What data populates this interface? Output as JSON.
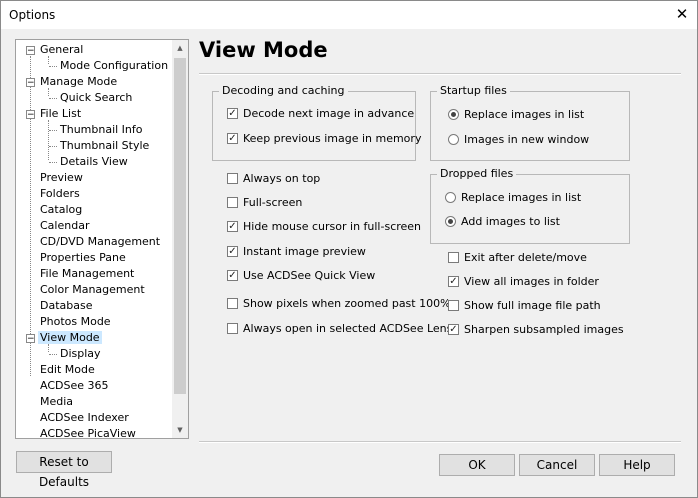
{
  "window": {
    "title": "Options",
    "close_glyph": "✕"
  },
  "tree": {
    "items": [
      {
        "label": "General",
        "expander": "−"
      },
      {
        "label": "Mode Configuration"
      },
      {
        "label": "Manage Mode",
        "expander": "−"
      },
      {
        "label": "Quick Search"
      },
      {
        "label": "File List",
        "expander": "−"
      },
      {
        "label": "Thumbnail Info"
      },
      {
        "label": "Thumbnail Style"
      },
      {
        "label": "Details View"
      },
      {
        "label": "Preview"
      },
      {
        "label": "Folders"
      },
      {
        "label": "Catalog"
      },
      {
        "label": "Calendar"
      },
      {
        "label": "CD/DVD Management"
      },
      {
        "label": "Properties Pane"
      },
      {
        "label": "File Management"
      },
      {
        "label": "Color Management"
      },
      {
        "label": "Database"
      },
      {
        "label": "Photos Mode"
      },
      {
        "label": "View Mode",
        "expander": "−",
        "selected": true
      },
      {
        "label": "Display"
      },
      {
        "label": "Edit Mode"
      },
      {
        "label": "ACDSee 365"
      },
      {
        "label": "Media"
      },
      {
        "label": "ACDSee Indexer"
      },
      {
        "label": "ACDSee PicaView"
      }
    ],
    "scroll_up": "▲",
    "scroll_down": "▼"
  },
  "panel": {
    "heading": "View Mode",
    "decoding": {
      "title": "Decoding and caching",
      "decode_next": {
        "label": "Decode next image in advance",
        "checked": true
      },
      "keep_previous": {
        "label": "Keep previous image in memory",
        "checked": true
      }
    },
    "startup": {
      "title": "Startup files",
      "options": [
        {
          "label": "Replace images in list",
          "selected": true
        },
        {
          "label": "Images in new window",
          "selected": false
        }
      ]
    },
    "dropped": {
      "title": "Dropped files",
      "options": [
        {
          "label": "Replace images in list",
          "selected": false
        },
        {
          "label": "Add images to list",
          "selected": true
        }
      ]
    },
    "left_options": [
      {
        "label": "Always on top",
        "checked": false
      },
      {
        "label": "Full-screen",
        "checked": false
      },
      {
        "label": "Hide mouse cursor in full-screen",
        "checked": true
      },
      {
        "label": "Instant image preview",
        "checked": true
      },
      {
        "label": "Use ACDSee Quick View",
        "checked": true
      },
      {
        "label": "Show pixels when zoomed past 100%",
        "checked": false
      },
      {
        "label": "Always open in selected ACDSee Lens",
        "checked": false
      }
    ],
    "right_options": [
      {
        "label": "Exit after delete/move",
        "checked": false
      },
      {
        "label": "View all images in folder",
        "checked": true
      },
      {
        "label": "Show full image file path",
        "checked": false
      },
      {
        "label": "Sharpen subsampled images",
        "checked": true
      }
    ]
  },
  "buttons": {
    "reset": "Reset to Defaults",
    "ok": "OK",
    "cancel": "Cancel",
    "help": "Help"
  },
  "check_glyph": "✓"
}
